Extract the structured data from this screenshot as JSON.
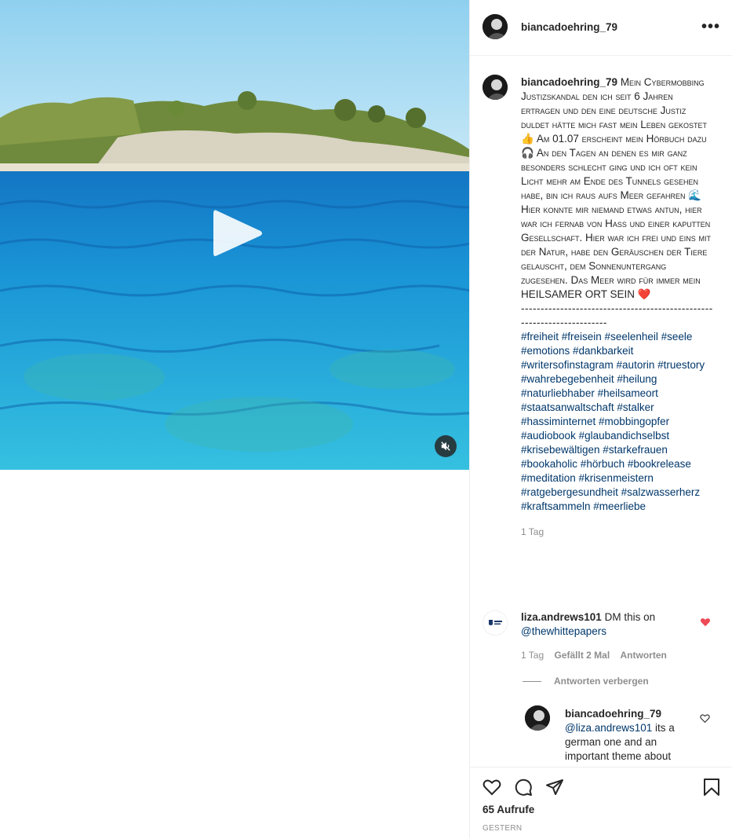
{
  "post": {
    "username": "biancadoehring_79",
    "more_icon": "more-horizontal-icon",
    "caption_text": "Mein Cybermobbing Justizskandal den ich seit 6 Jahren ertragen und den eine deutsche Justiz duldet hätte mich fast mein Leben gekostet 👍 Am 01.07 erscheint mein Hörbuch dazu 🎧 An den Tagen an denen es mir ganz besonders schlecht ging und ich oft kein Licht mehr am Ende des Tunnels gesehen habe, bin ich raus aufs Meer gefahren 🌊\nHier konnte mir niemand etwas antun, hier war ich fernab von Hass und einer kaputten Gesellschaft. Hier war ich frei und eins mit der Natur, habe den Geräuschen der Tiere gelauscht, dem Sonnenuntergang zugesehen. Das Meer wird für immer mein HEILSAMER ORT SEIN ❤️",
    "divider": "-----------------------------------------------------------------------",
    "hashtags": "#freiheit #freisein #seelenheil #seele #emotions #dankbarkeit #writersofinstagram #autorin #truestory #wahrebegebenheit #heilung #naturliebhaber #heilsameort #staatsanwaltschaft #stalker #hassiminternet #mobbingopfer #audiobook #glaubandichselbst #krisebewältigen #starkefrauen #bookaholic #hörbuch #bookrelease #meditation #krisenmeistern #ratgebergesundheit #salzwasserherz #kraftsammeln #meerliebe",
    "caption_age": "1 Tag",
    "views": "65 Aufrufe",
    "date": "GESTERN"
  },
  "comments": [
    {
      "username": "liza.andrews101",
      "text": "DM this on",
      "mention": "@thewhittepapers",
      "age": "1 Tag",
      "likes": "Gefällt 2 Mal",
      "reply_label": "Antworten",
      "liked": true,
      "hide_replies": "Antworten verbergen"
    },
    {
      "username": "biancadoehring_79",
      "mention": "@liza.andrews101",
      "text": "its a german one and an important theme about"
    }
  ],
  "video": {
    "play_icon": "play-icon",
    "mute_icon": "muted-speaker-icon"
  },
  "actions": {
    "like_icon": "heart-icon",
    "comment_icon": "comment-icon",
    "share_icon": "paper-plane-icon",
    "save_icon": "bookmark-icon"
  },
  "colors": {
    "link": "#00376b",
    "like_red": "#ed4956",
    "muted_text": "#8e8e8e"
  }
}
